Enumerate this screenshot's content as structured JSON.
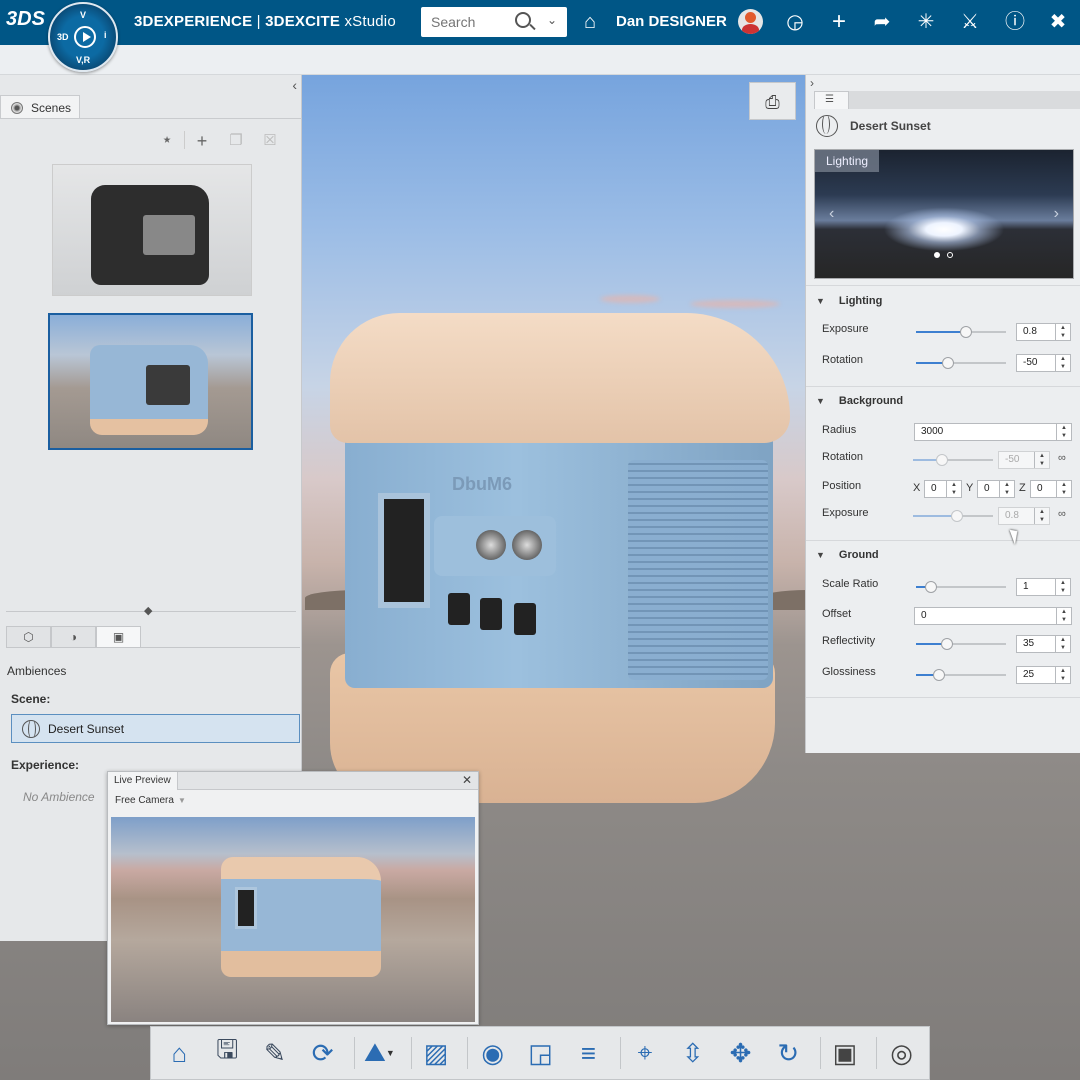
{
  "header": {
    "brand_logo": "3DS",
    "compass": {
      "top": "V",
      "left": "3D",
      "right": "i",
      "bottom": "V,R"
    },
    "app_brand": "3DEXPERIENCE",
    "app_sep": " | ",
    "app_suite": "3DEXCITE",
    "app_name": " xStudio",
    "search_placeholder": "Search",
    "user_name": "Dan DESIGNER",
    "icons": [
      "tag-icon",
      "avatar",
      "chat-icon",
      "add-icon",
      "share-icon",
      "network-icon",
      "collaboration-icon",
      "help-icon",
      "collapse-icon"
    ]
  },
  "left_panel": {
    "tab_label": "Scenes",
    "ambiences_label": "Ambiences",
    "scene_label": "Scene:",
    "scene_value": "Desert Sunset",
    "experience_label": "Experience:",
    "experience_value": "No Ambience"
  },
  "live_preview": {
    "title": "Live Preview",
    "camera": "Free Camera"
  },
  "right_panel": {
    "environment_name": "Desert Sunset",
    "preview_label": "Lighting",
    "carousel_active": 1,
    "carousel_count": 2,
    "sections": {
      "lighting": {
        "title": "Lighting",
        "exposure_label": "Exposure",
        "exposure_value": "0.8",
        "exposure_level": 0.55,
        "rotation_label": "Rotation",
        "rotation_value": "-50",
        "rotation_level": 0.36
      },
      "background": {
        "title": "Background",
        "radius_label": "Radius",
        "radius_value": "3000",
        "rotation_label": "Rotation",
        "rotation_value": "-50",
        "rotation_level": 0.36,
        "position_label": "Position",
        "x_label": "X",
        "x_value": "0",
        "y_label": "Y",
        "y_value": "0",
        "z_label": "Z",
        "z_value": "0",
        "exposure_label": "Exposure",
        "exposure_value": "0.8",
        "exposure_level": 0.55
      },
      "ground": {
        "title": "Ground",
        "scale_label": "Scale Ratio",
        "scale_value": "1",
        "scale_level": 0.17,
        "offset_label": "Offset",
        "offset_value": "0",
        "reflectivity_label": "Reflectivity",
        "reflectivity_value": "35",
        "reflectivity_level": 0.35,
        "glossiness_label": "Glossiness",
        "glossiness_value": "25",
        "glossiness_level": 0.25
      }
    }
  },
  "product_logo": "DbuM6",
  "action_bar": [
    "home-icon",
    "save-icon",
    "annotate-icon",
    "refresh-icon",
    "ambience-icon",
    "background-icon",
    "render-icon",
    "snapshot-icon",
    "layers-icon",
    "zoom-icon",
    "zoom-fit-icon",
    "pan-icon",
    "rotate-icon",
    "camera-icon",
    "visibility-icon"
  ]
}
